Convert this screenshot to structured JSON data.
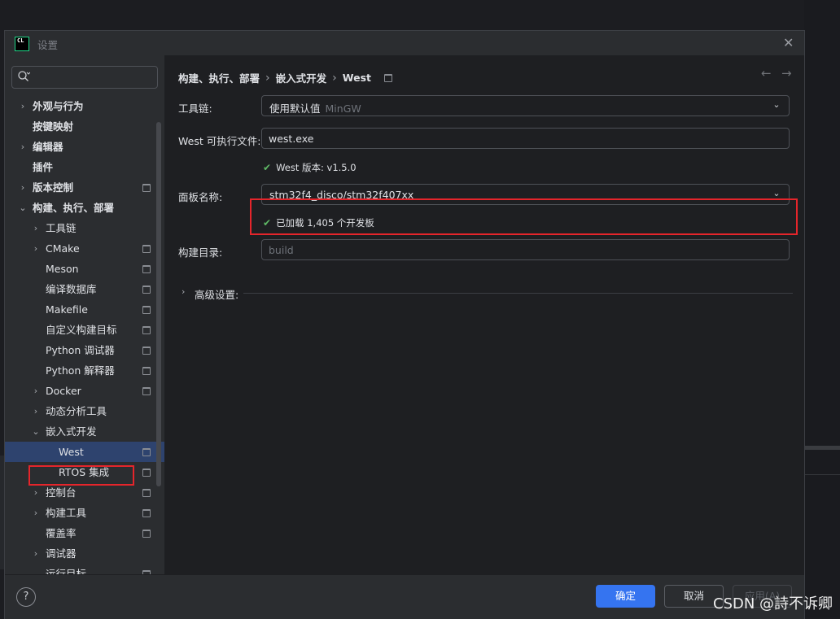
{
  "window": {
    "title": "设置",
    "logo_text": "CL"
  },
  "search": {
    "placeholder": "",
    "value": ""
  },
  "sidebar": {
    "items": [
      {
        "label": "外观与行为",
        "chevron": "›",
        "pin": false
      },
      {
        "label": "按键映射",
        "chevron": "",
        "pin": false
      },
      {
        "label": "编辑器",
        "chevron": "›",
        "pin": false
      },
      {
        "label": "插件",
        "chevron": "",
        "pin": false
      },
      {
        "label": "版本控制",
        "chevron": "›",
        "pin": true
      },
      {
        "label": "构建、执行、部署",
        "chevron": "⌄",
        "pin": false
      },
      {
        "label": "工具链",
        "chevron": "›",
        "pin": false
      },
      {
        "label": "CMake",
        "chevron": "›",
        "pin": true
      },
      {
        "label": "Meson",
        "chevron": "",
        "pin": true
      },
      {
        "label": "编译数据库",
        "chevron": "",
        "pin": true
      },
      {
        "label": "Makefile",
        "chevron": "",
        "pin": true
      },
      {
        "label": "自定义构建目标",
        "chevron": "",
        "pin": true
      },
      {
        "label": "Python 调试器",
        "chevron": "",
        "pin": true
      },
      {
        "label": "Python 解释器",
        "chevron": "",
        "pin": true
      },
      {
        "label": "Docker",
        "chevron": "›",
        "pin": true
      },
      {
        "label": "动态分析工具",
        "chevron": "›",
        "pin": false
      },
      {
        "label": "嵌入式开发",
        "chevron": "⌄",
        "pin": false
      },
      {
        "label": "West",
        "chevron": "",
        "pin": true,
        "selected": true
      },
      {
        "label": "RTOS 集成",
        "chevron": "",
        "pin": true
      },
      {
        "label": "控制台",
        "chevron": "›",
        "pin": true
      },
      {
        "label": "构建工具",
        "chevron": "›",
        "pin": true
      },
      {
        "label": "覆盖率",
        "chevron": "",
        "pin": true
      },
      {
        "label": "调试器",
        "chevron": "›",
        "pin": false
      },
      {
        "label": "运行目标",
        "chevron": "",
        "pin": true
      }
    ]
  },
  "breadcrumb": [
    "构建、执行、部署",
    "嵌入式开发",
    "West"
  ],
  "breadcrumb_sep": "›",
  "form": {
    "toolchain": {
      "label": "工具链:",
      "value": "使用默认值",
      "hint": "MinGW"
    },
    "west_exe": {
      "label": "West 可执行文件:",
      "value": "west.exe"
    },
    "west_version": "West 版本: v1.5.0",
    "board": {
      "label": "面板名称:",
      "value": "stm32f4_disco/stm32f407xx"
    },
    "boards_loaded": "已加载 1,405 个开发板",
    "build_dir": {
      "label": "构建目录:",
      "placeholder": "build"
    },
    "advanced": "高级设置:"
  },
  "footer": {
    "help": "?",
    "ok": "确定",
    "cancel": "取消",
    "apply": "应用(A)"
  },
  "watermark": "CSDN @詩不诉卿",
  "colors": {
    "accent": "#3574f0",
    "highlight": "#e5252b",
    "selection": "#2e436e",
    "success": "#5fb865"
  }
}
